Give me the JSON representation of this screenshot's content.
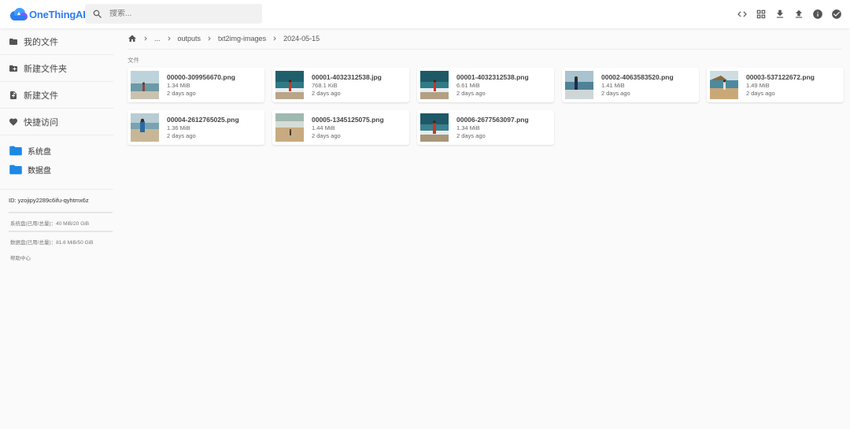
{
  "brand": {
    "name": "OneThingAI",
    "color": "#2b7cf6"
  },
  "search": {
    "placeholder": "搜索..."
  },
  "toolbar": {
    "icons": [
      "code-icon",
      "grid-view-icon",
      "download-icon",
      "upload-icon",
      "info-icon",
      "check-circle-icon"
    ]
  },
  "sidebar": {
    "items": [
      {
        "label": "我的文件",
        "icon": "folder-icon"
      },
      {
        "label": "新建文件夹",
        "icon": "create-folder-icon"
      },
      {
        "label": "新建文件",
        "icon": "new-file-icon"
      },
      {
        "label": "快捷访问",
        "icon": "heart-icon"
      }
    ],
    "disks": [
      {
        "label": "系统盘",
        "icon": "folder-icon"
      },
      {
        "label": "数据盘",
        "icon": "folder-icon"
      }
    ],
    "instance_id": "ID: yzojipy2289c6ifu-qyhtmx6z",
    "system_usage": "系统盘(已用/总量)：40 MiB/20 GiB",
    "data_usage": "数据盘(已用/总量)：81.6 MiB/50 GiB",
    "help": "帮助中心"
  },
  "breadcrumb": [
    "...",
    "outputs",
    "txt2img-images",
    "2024-05-15"
  ],
  "section_title": "文件",
  "files": [
    {
      "name": "00000-309956670.png",
      "size": "1.34 MiB",
      "modified": "2 days ago"
    },
    {
      "name": "00001-4032312538.jpg",
      "size": "768.1 KiB",
      "modified": "2 days ago"
    },
    {
      "name": "00001-4032312538.png",
      "size": "6.61 MiB",
      "modified": "2 days ago"
    },
    {
      "name": "00002-4063583520.png",
      "size": "1.41 MiB",
      "modified": "2 days ago"
    },
    {
      "name": "00003-537122672.png",
      "size": "1.49 MiB",
      "modified": "2 days ago"
    },
    {
      "name": "00004-2612765025.png",
      "size": "1.36 MiB",
      "modified": "2 days ago"
    },
    {
      "name": "00005-1345125075.png",
      "size": "1.44 MiB",
      "modified": "2 days ago"
    },
    {
      "name": "00006-2677563097.png",
      "size": "1.34 MiB",
      "modified": "2 days ago"
    }
  ]
}
